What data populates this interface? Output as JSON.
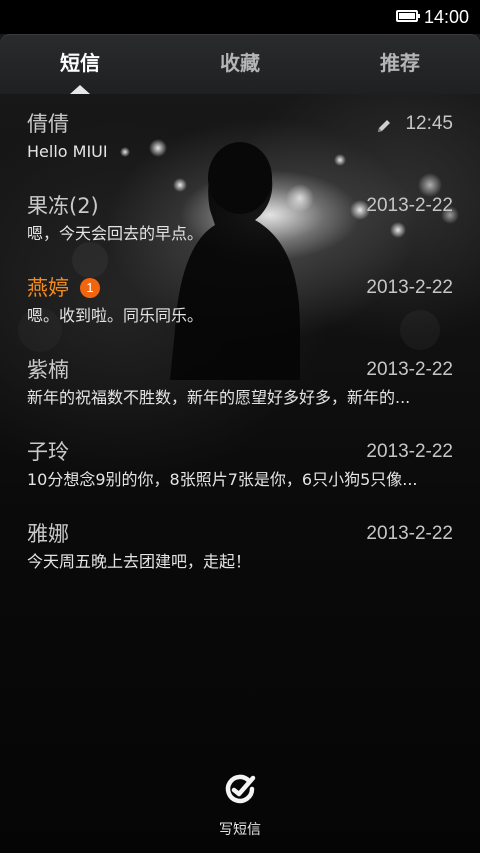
{
  "status_bar": {
    "time": "14:00"
  },
  "tabs": [
    {
      "label": "短信",
      "active": true
    },
    {
      "label": "收藏",
      "active": false
    },
    {
      "label": "推荐",
      "active": false
    }
  ],
  "conversations": [
    {
      "name": "倩倩",
      "count": "",
      "badge": "",
      "date": "12:45",
      "draft": true,
      "snippet": "Hello MIUI",
      "unread": false
    },
    {
      "name": "果冻",
      "count": "(2)",
      "badge": "",
      "date": "2013-2-22",
      "draft": false,
      "snippet": "嗯，今天会回去的早点。",
      "unread": false
    },
    {
      "name": "燕婷",
      "count": "",
      "badge": "1",
      "date": "2013-2-22",
      "draft": false,
      "snippet": "嗯。收到啦。同乐同乐。",
      "unread": true
    },
    {
      "name": "紫楠",
      "count": "",
      "badge": "",
      "date": "2013-2-22",
      "draft": false,
      "snippet": "新年的祝福数不胜数，新年的愿望好多好多，新年的...",
      "unread": false
    },
    {
      "name": "子玲",
      "count": "",
      "badge": "",
      "date": "2013-2-22",
      "draft": false,
      "snippet": "10分想念9别的你，8张照片7张是你，6只小狗5只像...",
      "unread": false
    },
    {
      "name": "雅娜",
      "count": "",
      "badge": "",
      "date": "2013-2-22",
      "draft": false,
      "snippet": "今天周五晚上去团建吧，走起！",
      "unread": false
    }
  ],
  "compose": {
    "label": "写短信",
    "icon": "compose-icon"
  },
  "colors": {
    "accent": "#f28a1f",
    "badge": "#f2650f"
  }
}
